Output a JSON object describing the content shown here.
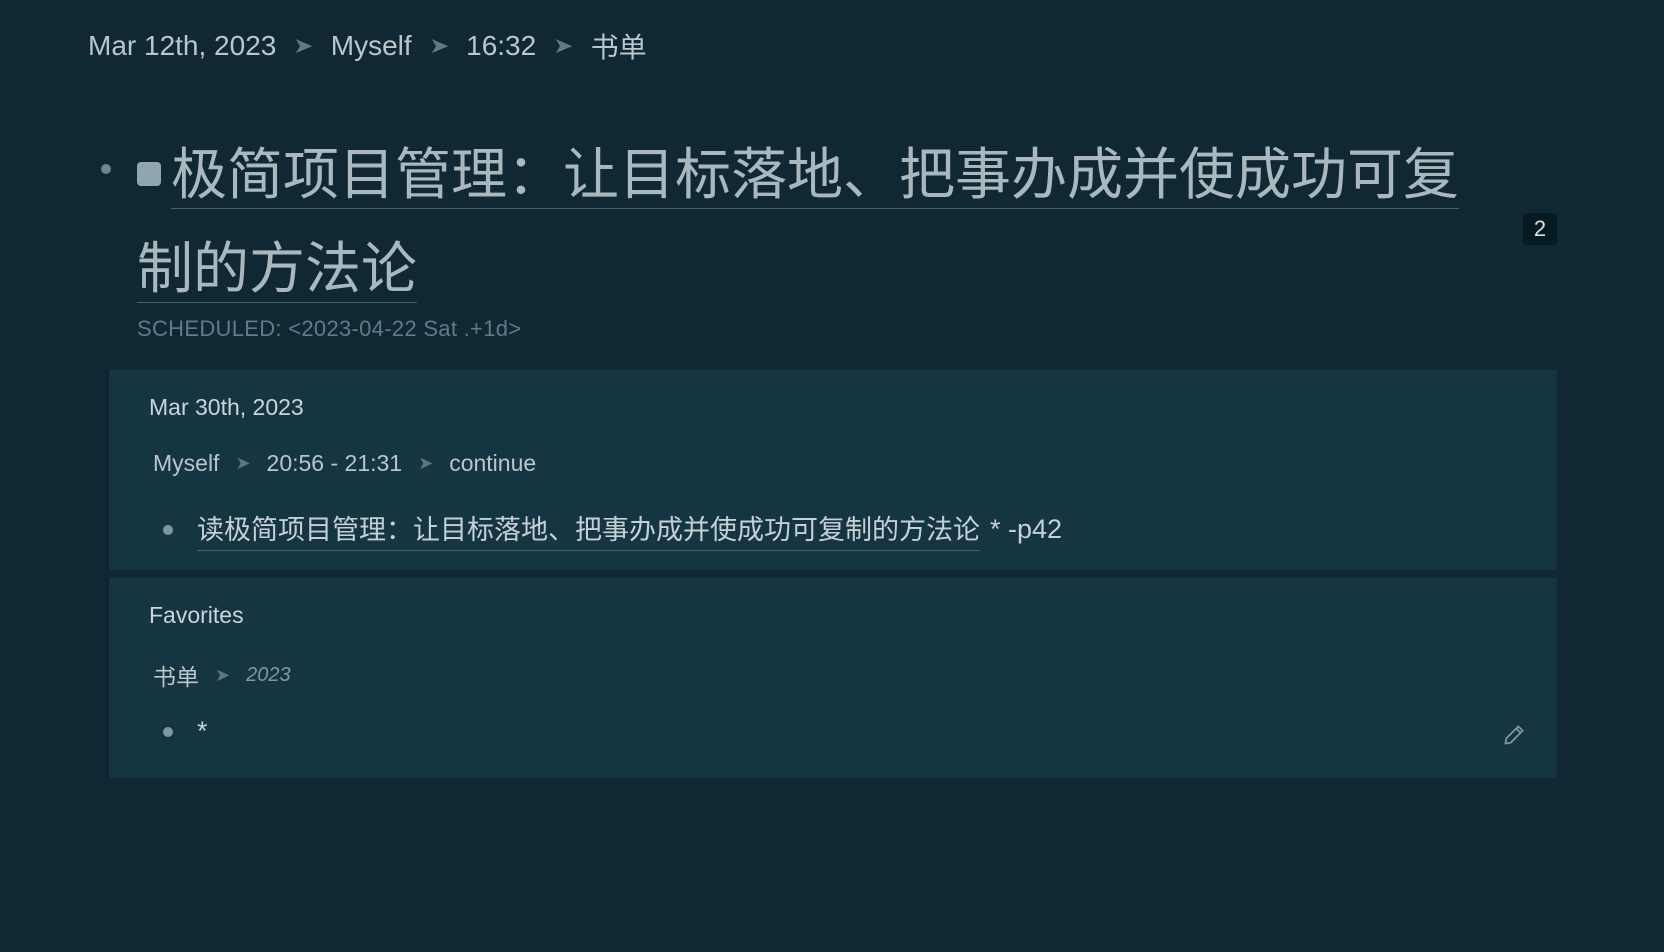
{
  "breadcrumb": {
    "items": [
      "Mar 12th, 2023",
      "Myself",
      "16:32",
      "书单"
    ]
  },
  "block": {
    "title_line1": "极简项目管理：让目标落地、把事办成并使成功可复",
    "title_line2": "制的方法论",
    "ref_count": "2",
    "scheduled": "SCHEDULED: <2023-04-22 Sat .+1d>"
  },
  "references": [
    {
      "title": "Mar 30th, 2023",
      "path": [
        "Myself",
        "20:56 - 21:31",
        "continue"
      ],
      "item_link": "读极简项目管理：让目标落地、把事办成并使成功可复制的方法论",
      "item_suffix": "* -p42"
    },
    {
      "title": "Favorites",
      "path": [
        "书单",
        "2023"
      ],
      "item_link": "",
      "item_suffix": "*"
    }
  ],
  "icons": {
    "separator": "chevron-right-icon",
    "edit": "pencil-icon",
    "task_marker": "todo-square-icon"
  },
  "colors": {
    "background": "#0f2833",
    "panel": "#163543",
    "text": "#c6d3d8",
    "muted": "#5f7d88"
  }
}
